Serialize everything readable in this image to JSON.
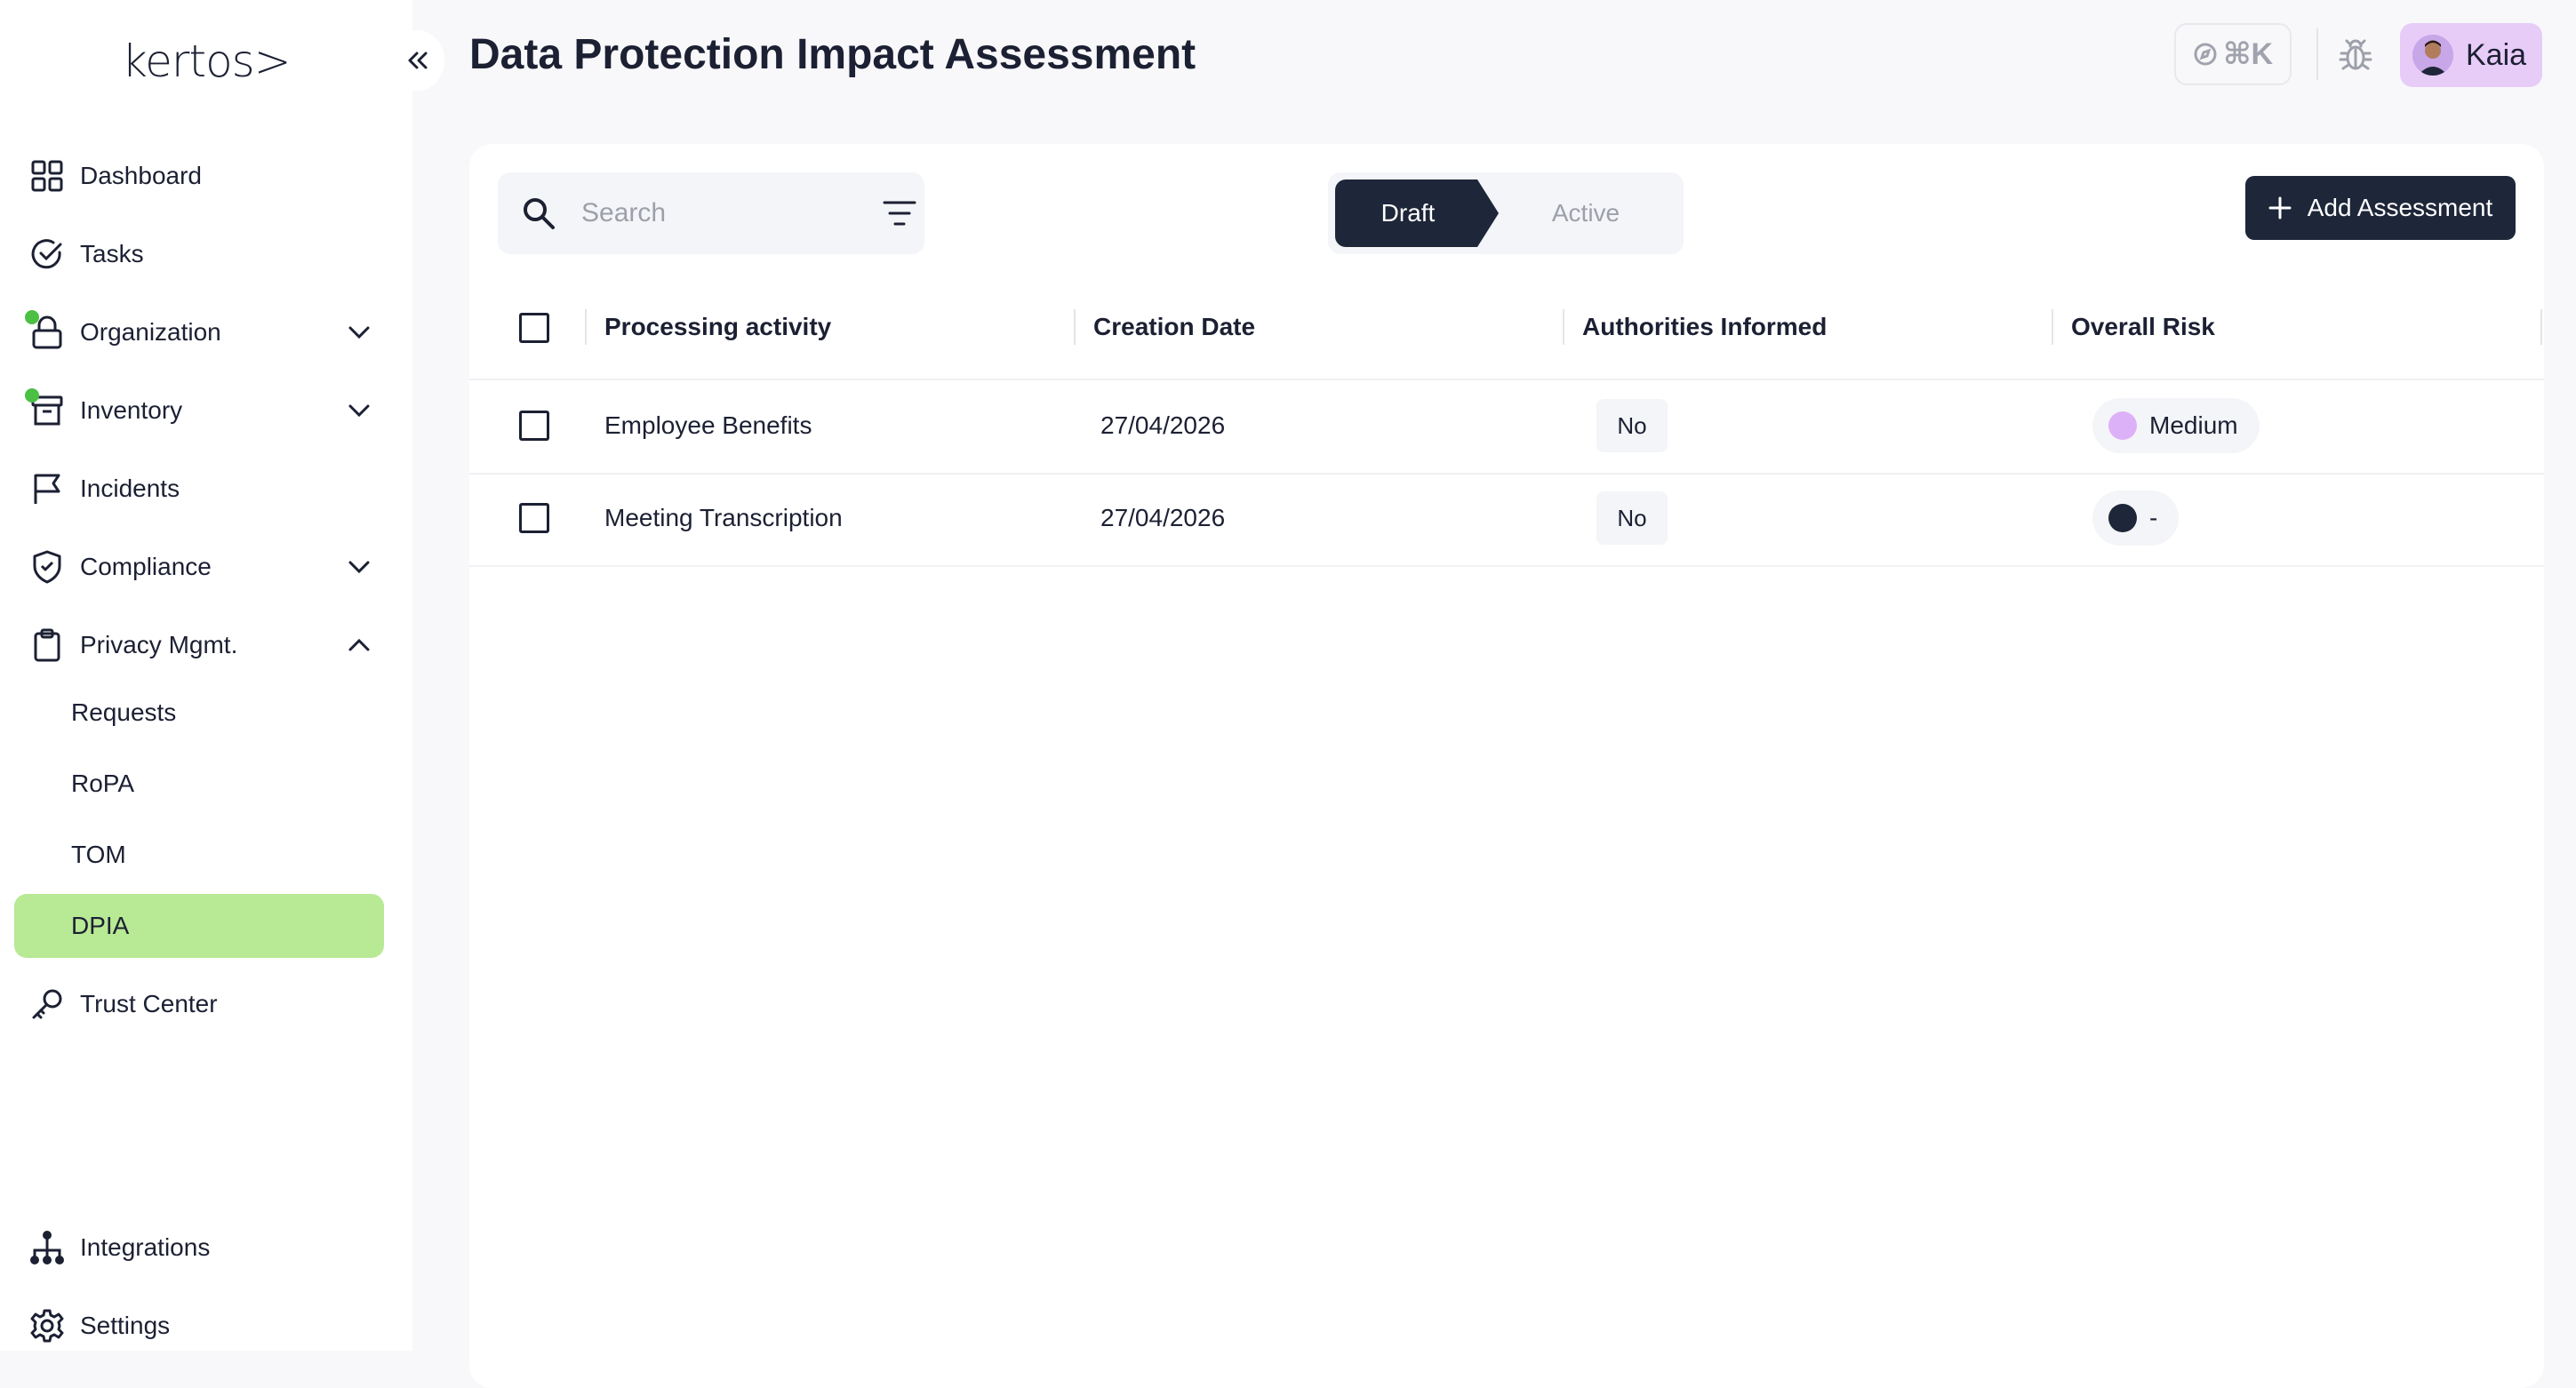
{
  "app": {
    "logo": "kertos>",
    "page_title": "Data Protection Impact Assessment"
  },
  "sidebar": {
    "items": [
      {
        "label": "Dashboard",
        "icon": "dashboard-grid-icon"
      },
      {
        "label": "Tasks",
        "icon": "check-circle-icon"
      },
      {
        "label": "Organization",
        "icon": "lock-icon",
        "has_dot": true,
        "expandable": true
      },
      {
        "label": "Inventory",
        "icon": "archive-box-icon",
        "has_dot": true,
        "expandable": true
      },
      {
        "label": "Incidents",
        "icon": "flag-icon"
      },
      {
        "label": "Compliance",
        "icon": "shield-check-icon",
        "expandable": true
      },
      {
        "label": "Privacy Mgmt.",
        "icon": "clipboard-icon",
        "expandable": true,
        "expanded": true
      },
      {
        "label": "Trust Center",
        "icon": "key-icon"
      },
      {
        "label": "Integrations",
        "icon": "hierarchy-icon"
      },
      {
        "label": "Settings",
        "icon": "gear-icon"
      }
    ],
    "privacy_sub_items": [
      {
        "label": "Requests"
      },
      {
        "label": "RoPA"
      },
      {
        "label": "TOM"
      },
      {
        "label": "DPIA",
        "active": true
      }
    ],
    "status_dot_color": "#4cbf45",
    "active_color": "#b8e994"
  },
  "header": {
    "command_shortcut": "⌘K",
    "user_name": "Kaia"
  },
  "toolbar": {
    "search_placeholder": "Search",
    "tabs": [
      {
        "label": "Draft",
        "selected": true
      },
      {
        "label": "Active",
        "selected": false
      }
    ],
    "add_button_label": "Add Assessment"
  },
  "table": {
    "columns": [
      "Processing activity",
      "Creation Date",
      "Authorities Informed",
      "Overall Risk"
    ],
    "rows": [
      {
        "activity": "Employee Benefits",
        "date": "27/04/2026",
        "authorities": "No",
        "risk": "Medium",
        "risk_color": "#ddb1f7"
      },
      {
        "activity": "Meeting Transcription",
        "date": "27/04/2026",
        "authorities": "No",
        "risk": "-",
        "risk_color": "#1e2639"
      }
    ]
  },
  "colors": {
    "primary_dark": "#1e2639",
    "background": "#f8f8fa",
    "user_chip": "#e8ccf8"
  }
}
